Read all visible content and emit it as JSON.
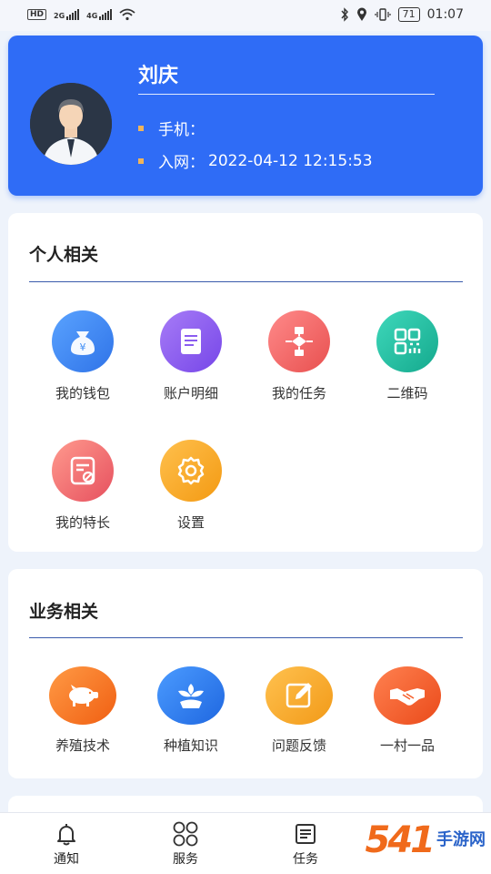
{
  "status_bar": {
    "left_badge": "HD",
    "net1": "2G",
    "net2": "4G",
    "battery": "71",
    "time": "01:07"
  },
  "profile": {
    "name": "刘庆",
    "phone_label": "手机：",
    "phone_value": "",
    "join_label": "入网：",
    "join_value": "2022-04-12 12:15:53"
  },
  "personal": {
    "title": "个人相关",
    "items": [
      {
        "label": "我的钱包",
        "icon": "money-bag-icon",
        "color": "#3f8ef5"
      },
      {
        "label": "账户明细",
        "icon": "document-icon",
        "color": "#8a5cf0"
      },
      {
        "label": "我的任务",
        "icon": "flowchart-icon",
        "color": "#f06a6a"
      },
      {
        "label": "二维码",
        "icon": "qr-code-icon",
        "color": "#26c2a4"
      },
      {
        "label": "我的特长",
        "icon": "certificate-icon",
        "color": "#f36f6f"
      },
      {
        "label": "设置",
        "icon": "gear-icon",
        "color": "#f5a623"
      }
    ]
  },
  "business": {
    "title": "业务相关",
    "items": [
      {
        "label": "养殖技术",
        "icon": "pig-icon",
        "color": "#f77a2a"
      },
      {
        "label": "种植知识",
        "icon": "plant-icon",
        "color": "#2f7ff0"
      },
      {
        "label": "问题反馈",
        "icon": "edit-icon",
        "color": "#f5a623"
      },
      {
        "label": "一村一品",
        "icon": "handshake-icon",
        "color": "#f5622e"
      }
    ]
  },
  "nav": {
    "items": [
      {
        "label": "通知",
        "icon": "bell-icon"
      },
      {
        "label": "服务",
        "icon": "grid-icon"
      },
      {
        "label": "任务",
        "icon": "task-list-icon"
      }
    ]
  },
  "watermark": {
    "big": "541",
    "small": "手游网"
  }
}
